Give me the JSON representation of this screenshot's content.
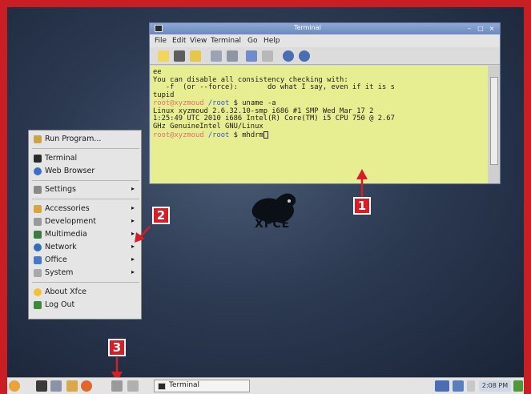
{
  "terminal": {
    "title": "Terminal",
    "menu": [
      "File",
      "Edit",
      "View",
      "Terminal",
      "Go",
      "Help"
    ],
    "lines": [
      "ee",
      "You can disable all consistency checking with:",
      "   -f  (or --force):       do what I say, even if it is s",
      "tupid",
      {
        "user": "root@xyzmoud",
        "path": "/root",
        "cmd": " $ uname -a"
      },
      "Linux xyzmoud 2.6.32.10-smp i686 #1 SMP Wed Mar 17 2",
      "1:25:49 UTC 2010 i686 Intel(R) Core(TM) i5 CPU 750 @ 2.67",
      "GHz GenuineIntel GNU/Linux",
      {
        "user": "root@xyzmoud",
        "path": "/root",
        "cmd": " $ mhdrm"
      }
    ]
  },
  "desktop": {
    "wallpaper_text": "XFCE"
  },
  "appmenu": {
    "items": [
      {
        "label": "Run Program...",
        "icon": "run-icon",
        "submenu": false
      },
      {
        "label": "Terminal",
        "icon": "terminal-icon",
        "submenu": false
      },
      {
        "label": "Web Browser",
        "icon": "globe-icon",
        "submenu": false
      },
      {
        "label": "Settings",
        "icon": "settings-icon",
        "submenu": true
      },
      {
        "label": "Accessories",
        "icon": "accessories-icon",
        "submenu": true
      },
      {
        "label": "Development",
        "icon": "development-icon",
        "submenu": true
      },
      {
        "label": "Multimedia",
        "icon": "multimedia-icon",
        "submenu": true
      },
      {
        "label": "Network",
        "icon": "network-icon",
        "submenu": true
      },
      {
        "label": "Office",
        "icon": "office-icon",
        "submenu": true
      },
      {
        "label": "System",
        "icon": "system-icon",
        "submenu": true
      },
      {
        "label": "About Xfce",
        "icon": "star-icon",
        "submenu": false
      },
      {
        "label": "Log Out",
        "icon": "logout-icon",
        "submenu": false
      }
    ]
  },
  "callouts": [
    "1",
    "2",
    "3"
  ],
  "taskbar": {
    "task_label": "Terminal",
    "clock": "2:08 PM"
  },
  "colors": {
    "callout_red": "#d41f26",
    "terminal_bg": "#e7ee92",
    "desktop": "#2c3a52"
  }
}
